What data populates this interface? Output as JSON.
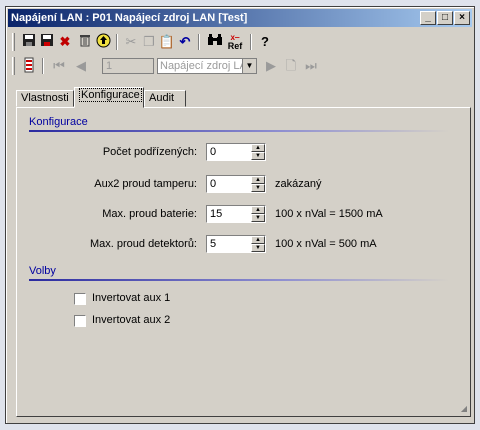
{
  "window": {
    "title": "Napájení LAN : P01 Napájecí zdroj LAN [Test]"
  },
  "titlebar_buttons": {
    "minimize": "_",
    "maximize": "□",
    "close": "×"
  },
  "toolbar": {
    "ref_label": "Ref",
    "record_number": "1",
    "record_selector": "Napájecí zdroj LA"
  },
  "tabs": [
    "Vlastnosti",
    "Konfigurace",
    "Audit"
  ],
  "sections": {
    "konfigurace": "Konfigurace",
    "volby": "Volby"
  },
  "fields": [
    {
      "label": "Počet podřízených:",
      "value": "0",
      "note": ""
    },
    {
      "label": "Aux2 proud tamperu:",
      "value": "0",
      "note": "zakázaný"
    },
    {
      "label": "Max. proud baterie:",
      "value": "15",
      "note": "100 x nVal = 1500 mA"
    },
    {
      "label": "Max. proud detektorů:",
      "value": "5",
      "note": "100 x nVal = 500 mA"
    }
  ],
  "options": [
    {
      "label": "Invertovat aux 1",
      "checked": false
    },
    {
      "label": "Invertovat aux 2",
      "checked": false
    }
  ],
  "colors": {
    "section_heading": "#0000a0",
    "titlebar_start": "#0a246a",
    "titlebar_end": "#a6caf0"
  }
}
